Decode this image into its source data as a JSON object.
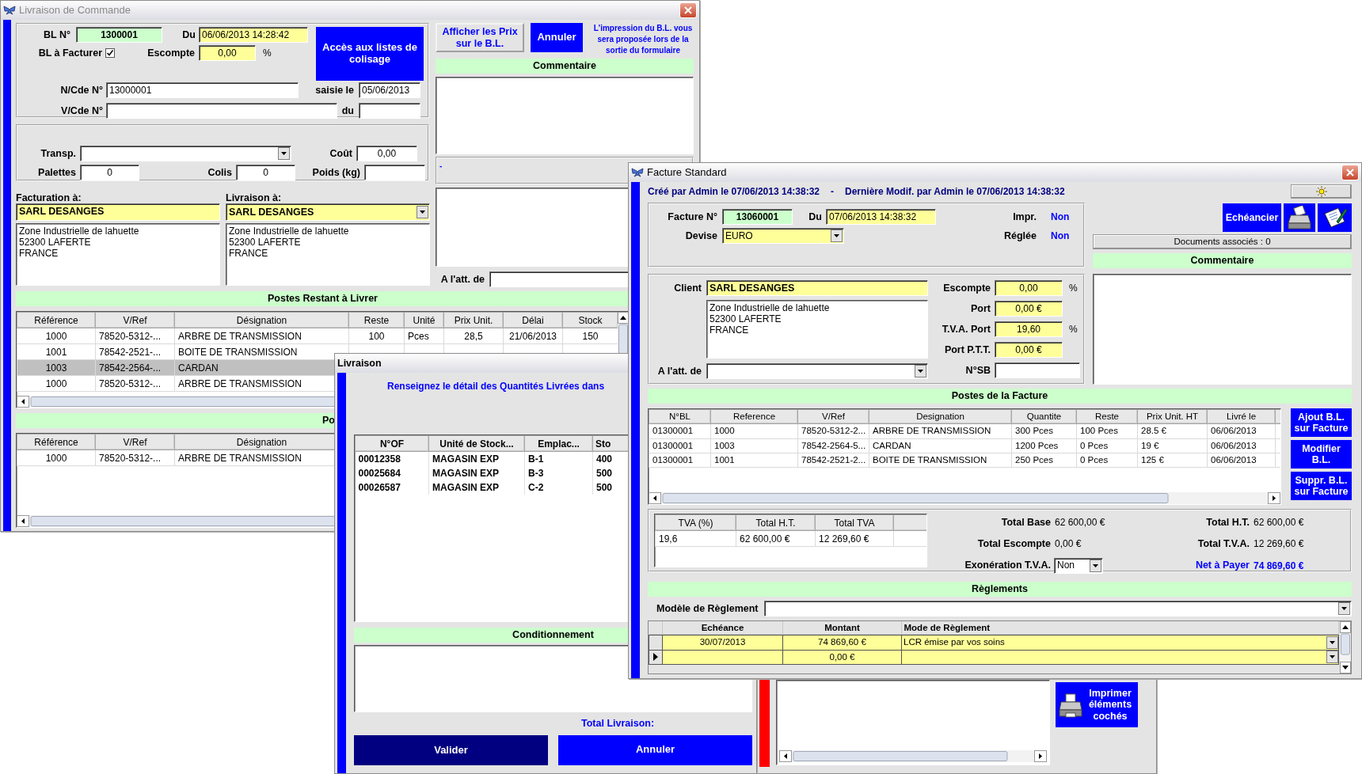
{
  "delivery_order_window": {
    "title": "Livraison de Commande",
    "bl_label": "BL N°",
    "bl_number": "1300001",
    "date_label": "Du",
    "date": "06/06/2013 14:28:42",
    "to_invoice_label": "BL à Facturer",
    "to_invoice_checked": true,
    "discount_label": "Escompte",
    "discount": "0,00",
    "discount_unit": "%",
    "packing_button": "Accès aux listes de colisage",
    "order_label": "N/Cde N°",
    "order_number": "13000001",
    "entry_label": "saisie le",
    "entry_date": "05/06/2013",
    "customer_order_label": "V/Cde N°",
    "customer_order_date_label": "du",
    "carrier_label": "Transp.",
    "cost_label": "Coût",
    "cost": "0,00",
    "pallets_label": "Palettes",
    "pallets": "0",
    "parcels_label": "Colis",
    "parcels": "0",
    "weight_label": "Poids (kg)",
    "billing": {
      "label": "Facturation à:",
      "name": "SARL DESANGES",
      "address": [
        "Zone Industrielle de lahuette",
        "52300 LAFERTE",
        "FRANCE"
      ]
    },
    "shipping": {
      "label": "Livraison à:",
      "name": "SARL DESANGES",
      "address": [
        "Zone Industrielle de lahuette",
        "52300 LAFERTE",
        "FRANCE"
      ]
    },
    "show_prices_button": "Afficher les Prix sur le B.L.",
    "cancel_button": "Annuler",
    "print_note": "L'impression du B.L. vous sera proposée lors de la sortie du formulaire",
    "comment_header": "Commentaire",
    "dash": "-",
    "attention_label": "A l'att. de",
    "remaining_items": {
      "header": "Postes Restant à Livrer",
      "columns": [
        "Référence",
        "V/Ref",
        "Désignation",
        "Reste",
        "Unité",
        "Prix Unit.",
        "Délai",
        "Stock"
      ],
      "rows": [
        {
          "selected": false,
          "cells": [
            "1000",
            "78520-5312-...",
            "ARBRE DE TRANSMISSION",
            "100",
            "Pces",
            "28,5",
            "21/06/2013",
            "150"
          ]
        },
        {
          "selected": false,
          "cells": [
            "1001",
            "78542-2521-...",
            "BOITE DE TRANSMISSION"
          ]
        },
        {
          "selected": true,
          "cells": [
            "1003",
            "78542-2564-...",
            "CARDAN"
          ]
        },
        {
          "selected": false,
          "cells": [
            "1000",
            "78520-5312-...",
            "ARBRE DE TRANSMISSION"
          ]
        }
      ]
    },
    "delivered_items": {
      "header": "Po",
      "columns": [
        "Référence",
        "V/Ref",
        "Désignation"
      ],
      "rows": [
        {
          "cells": [
            "1000",
            "78520-5312-...",
            "ARBRE DE TRANSMISSION"
          ]
        }
      ]
    }
  },
  "delivery_window": {
    "title": "Livraison",
    "instruction": "Renseignez le détail des Quantités Livrées dans",
    "columns": [
      "N°OF",
      "Unité de Stock...",
      "Emplac...",
      "Sto"
    ],
    "rows": [
      [
        "00012358",
        "MAGASIN EXP",
        "B-1",
        "400"
      ],
      [
        "00025684",
        "MAGASIN EXP",
        "B-3",
        "500"
      ],
      [
        "00026587",
        "MAGASIN EXP",
        "C-2",
        "500"
      ]
    ],
    "packaging_header": "Conditionnement",
    "total_label": "Total Livraison:",
    "validate_button": "Valider",
    "cancel_button": "Annuler"
  },
  "invoice_window": {
    "title": "Facture Standard",
    "created": "Créé par Admin le 07/06/2013 14:38:32",
    "separator": "-",
    "modified": "Dernière Modif. par Admin le 07/06/2013 14:38:32",
    "invoice_label": "Facture N°",
    "invoice_number": "13060001",
    "date_label": "Du",
    "date": "07/06/2013 14:38:32",
    "printed_label": "Impr.",
    "printed": "Non",
    "currency_label": "Devise",
    "currency": "EURO",
    "paid_label": "Réglée",
    "paid": "Non",
    "schedule_button": "Echéancier",
    "documents_button": "Documents associés : 0",
    "comment_header": "Commentaire",
    "client_label": "Client",
    "client_name": "SARL DESANGES",
    "client_address": [
      "Zone Industrielle de lahuette",
      "52300 LAFERTE",
      "FRANCE"
    ],
    "attention_label": "A l'att. de",
    "charges": [
      {
        "label": "Escompte",
        "value": "0,00",
        "unit": "%"
      },
      {
        "label": "Port",
        "value": "0,00 €"
      },
      {
        "label": "T.V.A. Port",
        "value": "19,60",
        "unit": "%"
      },
      {
        "label": "Port P.T.T.",
        "value": "0,00 €"
      },
      {
        "label": "N°SB"
      }
    ],
    "lines": {
      "header": "Postes de la Facture",
      "columns": [
        "N°BL",
        "Reference",
        "V/Ref",
        "Designation",
        "Quantite",
        "Reste",
        "Prix Unit. HT",
        "Livré le"
      ],
      "rows": [
        [
          "01300001",
          "1000",
          "78520-5312-2...",
          "ARBRE DE TRANSMISSION",
          "300 Pces",
          "100 Pces",
          "28.5 €",
          "06/06/2013"
        ],
        [
          "01300001",
          "1003",
          "78542-2564-5...",
          "CARDAN",
          "1200 Pces",
          "0 Pces",
          "19 €",
          "06/06/2013"
        ],
        [
          "01300001",
          "1001",
          "78542-2521-2...",
          "BOITE DE TRANSMISSION",
          "250 Pces",
          "0 Pces",
          "125 €",
          "06/06/2013"
        ]
      ]
    },
    "line_buttons": [
      "Ajout B.L. sur Facture",
      "Modifier B.L.",
      "Suppr. B.L. sur Facture"
    ],
    "vat_table": {
      "columns": [
        "TVA (%)",
        "Total H.T.",
        "Total TVA"
      ],
      "rows": [
        [
          "19,6",
          "62 600,00 €",
          "12 269,60 €"
        ]
      ]
    },
    "totals_left": [
      {
        "label": "Total Base",
        "value": "62 600,00 €"
      },
      {
        "label": "Total Escompte",
        "value": "0,00 €"
      }
    ],
    "exemption_label": "Exonération T.V.A.",
    "exemption": "Non",
    "totals_right": [
      {
        "label": "Total H.T.",
        "value": "62 600,00 €",
        "highlight": false
      },
      {
        "label": "Total T.V.A.",
        "value": "12 269,60 €",
        "highlight": false
      },
      {
        "label": "Net à Payer",
        "value": "74 869,60 €",
        "highlight": true
      }
    ],
    "payments": {
      "header": "Règlements",
      "model_label": "Modèle de Règlement",
      "columns": [
        "Echéance",
        "Montant",
        "Mode de Règlement"
      ],
      "rows": [
        {
          "current": false,
          "due": "30/07/2013",
          "amount": "74 869,60 €",
          "mode": "LCR émise par vos soins"
        },
        {
          "current": true,
          "amount": "0,00 €"
        }
      ]
    }
  },
  "background_window": {
    "print_button": "Imprimer éléments cochés"
  }
}
